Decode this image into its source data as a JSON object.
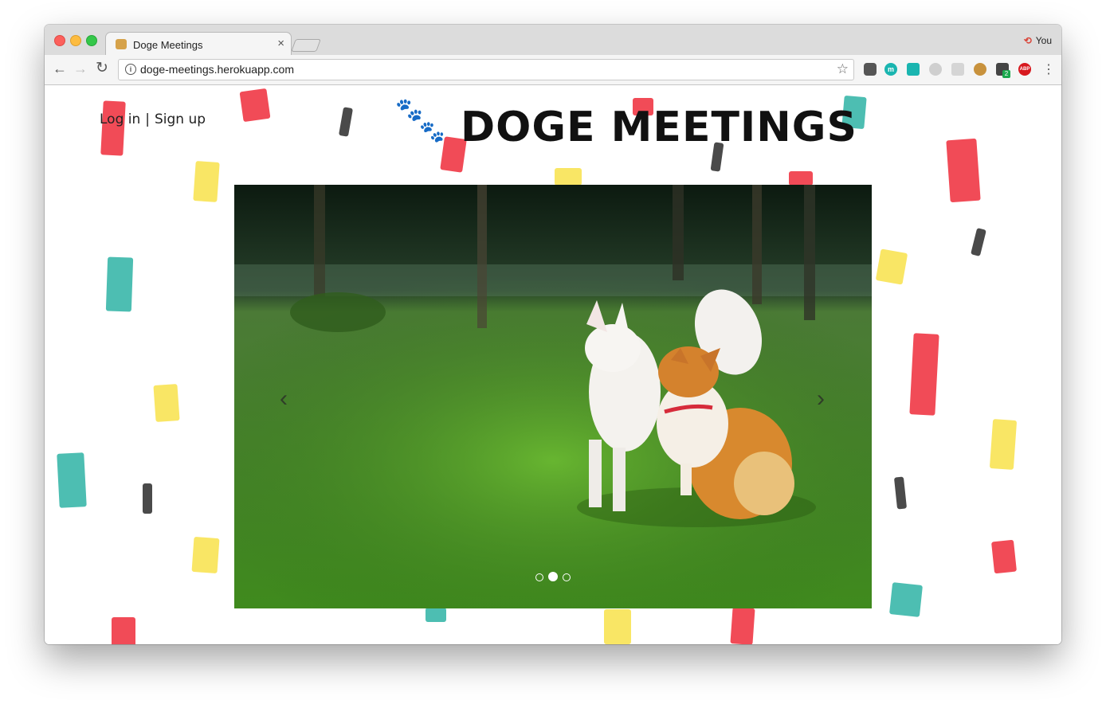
{
  "browser": {
    "tab_title": "Doge Meetings",
    "url": "doge-meetings.herokuapp.com",
    "profile_name": "You",
    "extension_badge": "2",
    "extension_abp": "ABP"
  },
  "page": {
    "login_label": "Log in",
    "separator": "|",
    "signup_label": "Sign up",
    "site_title": "DOGE MEETINGS"
  },
  "carousel": {
    "slide_count": 3,
    "active_index": 1
  },
  "colors": {
    "paw": "#c2151d",
    "red_stroke": "#ee2b3a",
    "yellow_stroke": "#f8e24a",
    "teal_stroke": "#2eb3a4"
  }
}
